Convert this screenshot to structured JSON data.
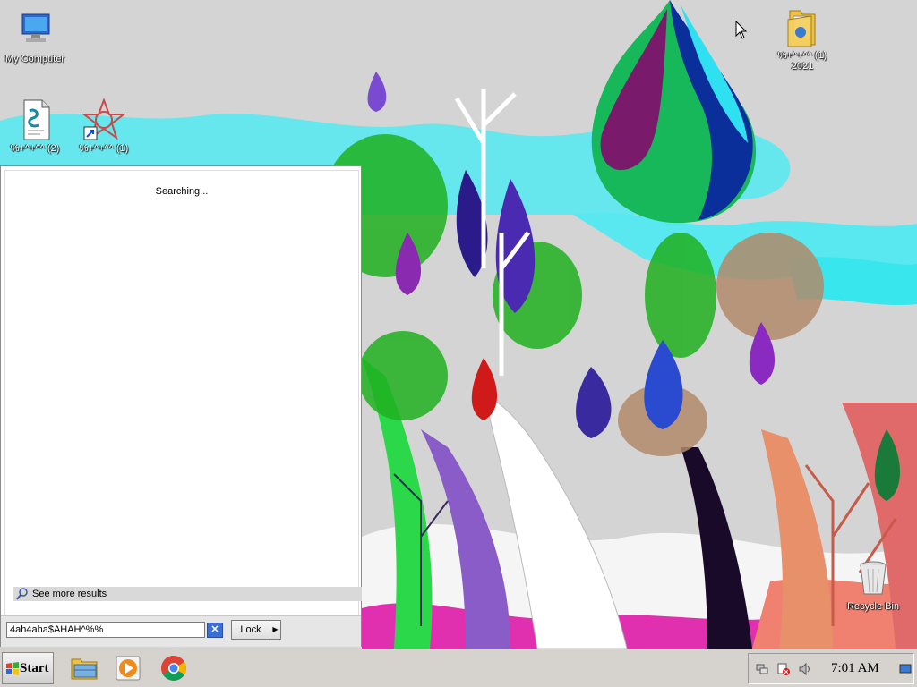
{
  "desktop": {
    "icons": {
      "my_computer": "My Computer",
      "text_file": "%+^+^^ (2)",
      "app_shortcut": "%+^+^^ (1)",
      "folder": "%+^+^^ (1) 2021",
      "recycle_bin": "Recycle Bin"
    }
  },
  "start_panel": {
    "status": "Searching...",
    "see_more": "See more results",
    "search_value": "4ah4aha$AHAH^%%",
    "lock_label": "Lock",
    "clear_icon": "clear-search-icon"
  },
  "taskbar": {
    "start_label": "Start",
    "pinned": [
      "file-explorer-icon",
      "media-player-icon",
      "chrome-icon"
    ],
    "clock": "7:01 AM"
  }
}
